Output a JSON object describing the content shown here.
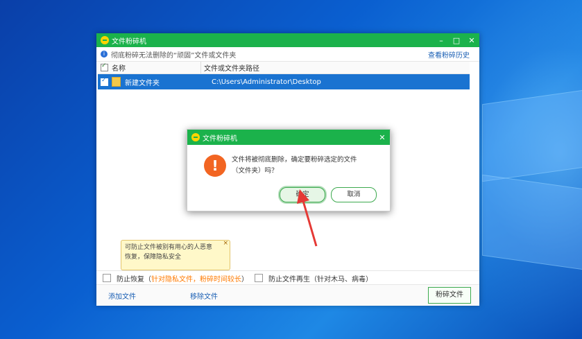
{
  "app": {
    "title": "文件粉碎机",
    "win_min": "–",
    "win_max": "□",
    "win_close": "✕"
  },
  "info": {
    "text": "彻底粉碎无法删除的“顽固”文件或文件夹",
    "history_link": "查看粉碎历史"
  },
  "list": {
    "headers": [
      "名称",
      "文件或文件夹路径"
    ],
    "rows": [
      {
        "name": "新建文件夹",
        "path": "C:\\Users\\Administrator\\Desktop",
        "checked": true
      }
    ]
  },
  "tooltip": {
    "line1": "可防止文件被别有用心的人恶意",
    "line2": "恢复，保障隐私安全",
    "close": "×"
  },
  "options": {
    "prevent_recover": "防止恢复",
    "prevent_recover_note": "针对隐私文件，粉碎时间较长",
    "paren_open": "（",
    "paren_close": "）",
    "prevent_regen": "防止文件再生（针对木马、病毒）"
  },
  "bottom": {
    "add_file": "添加文件",
    "remove_file": "移除文件",
    "shred_button": "粉碎文件"
  },
  "dialog": {
    "title": "文件粉碎机",
    "close": "✕",
    "icon_glyph": "!",
    "message_line1": "文件将被彻底删除，确定要粉碎选定的文件",
    "message_line2": "（文件夹）吗？",
    "ok": "确定",
    "cancel": "取消"
  },
  "colors": {
    "title_green": "#1bb24b",
    "selection_blue": "#1a73d1",
    "warn_orange": "#f26522",
    "arrow_red": "#e53935"
  }
}
